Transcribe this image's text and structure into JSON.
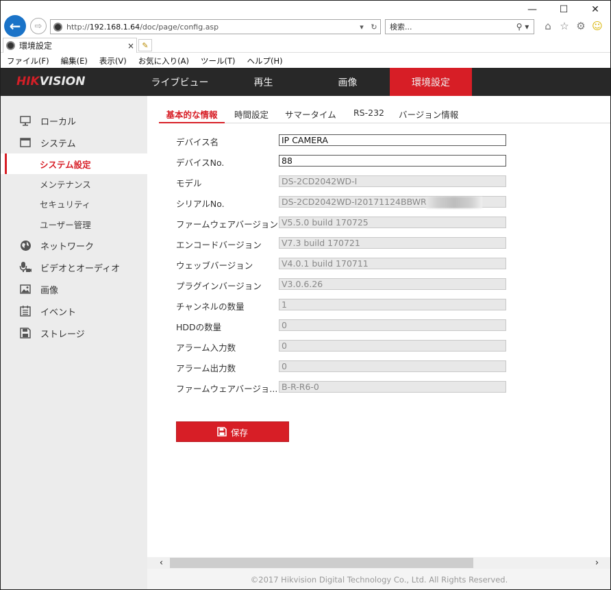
{
  "browser": {
    "address_prefix": "http://",
    "address_host": "192.168.1.64",
    "address_path": "/doc/page/config.asp",
    "search_placeholder": "検索...",
    "tab_title": "環境設定",
    "tab_close": "×",
    "menu": [
      "ファイル(F)",
      "編集(E)",
      "表示(V)",
      "お気に入り(A)",
      "ツール(T)",
      "ヘルプ(H)"
    ],
    "window_controls": {
      "minimize": "—",
      "maximize": "☐",
      "close": "✕"
    }
  },
  "header": {
    "logo_hik": "HIK",
    "logo_vision": "VISION",
    "nav": [
      "ライブビュー",
      "再生",
      "画像",
      "環境設定"
    ],
    "active_nav": "環境設定"
  },
  "sidebar": {
    "local": "ローカル",
    "system": "システム",
    "system_sub": [
      "システム設定",
      "メンテナンス",
      "セキュリティ",
      "ユーザー管理"
    ],
    "network": "ネットワーク",
    "video_audio": "ビデオとオーディオ",
    "image": "画像",
    "event": "イベント",
    "storage": "ストレージ"
  },
  "subtabs": [
    "基本的な情報",
    "時間設定",
    "サマータイム",
    "RS-232",
    "バージョン情報"
  ],
  "form": {
    "device_name": {
      "label": "デバイス名",
      "value": "IP CAMERA"
    },
    "device_no": {
      "label": "デバイスNo.",
      "value": "88"
    },
    "model": {
      "label": "モデル",
      "value": "DS-2CD2042WD-I"
    },
    "serial": {
      "label": "シリアルNo.",
      "value": "DS-2CD2042WD-I20171124BBWR"
    },
    "firmware": {
      "label": "ファームウェアバージョン",
      "value": "V5.5.0 build 170725"
    },
    "encode": {
      "label": "エンコードバージョン",
      "value": "V7.3 build 170721"
    },
    "web": {
      "label": "ウェッブバージョン",
      "value": "V4.0.1 build 170711"
    },
    "plugin": {
      "label": "プラグインバージョン",
      "value": "V3.0.6.26"
    },
    "channels": {
      "label": "チャンネルの数量",
      "value": "1"
    },
    "hdd": {
      "label": "HDDの数量",
      "value": "0"
    },
    "alarm_in": {
      "label": "アラーム入力数",
      "value": "0"
    },
    "alarm_out": {
      "label": "アラーム出力数",
      "value": "0"
    },
    "firmware2": {
      "label": "ファームウェアバージョ...",
      "value": "B-R-R6-0"
    }
  },
  "save_label": "保存",
  "footer": "©2017 Hikvision Digital Technology Co., Ltd. All Rights Reserved.",
  "colors": {
    "accent": "#d71e26",
    "header_bg": "#282828",
    "sidebar_bg": "#ececec"
  }
}
